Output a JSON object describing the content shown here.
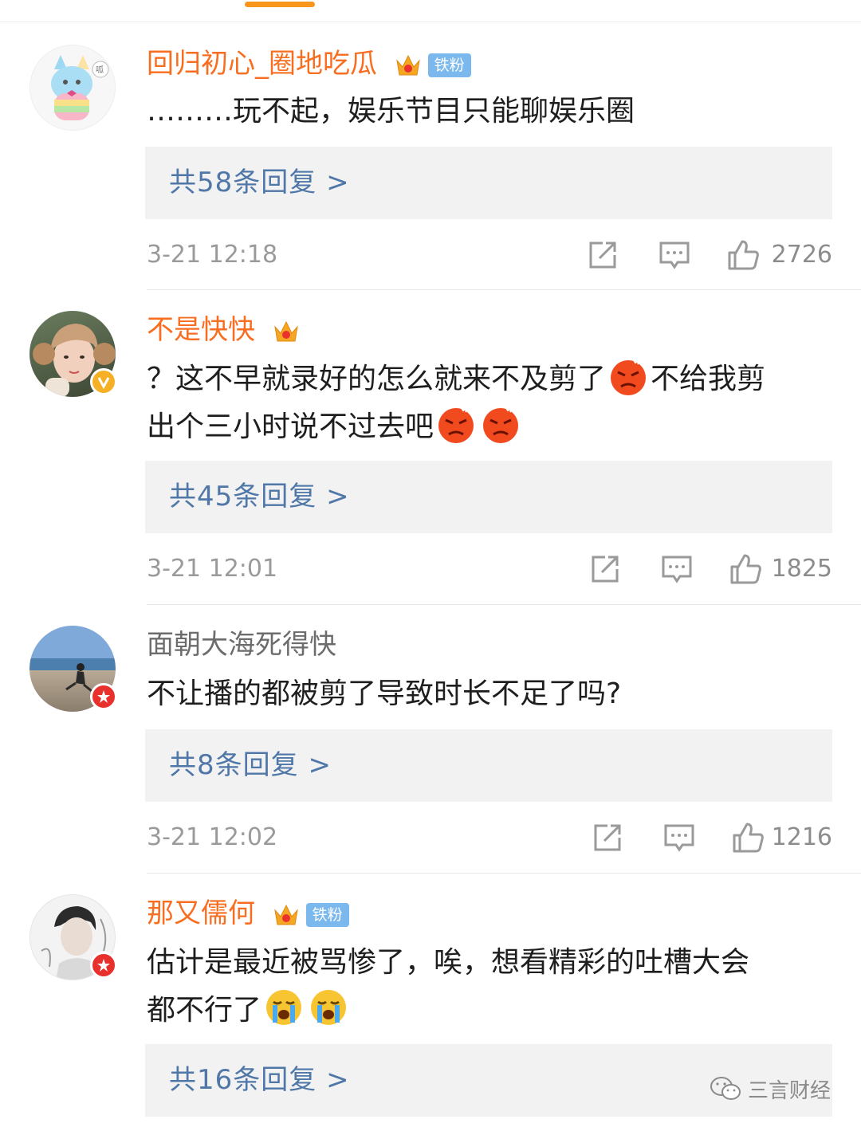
{
  "comments": [
    {
      "username": "回归初心_圈地吃瓜",
      "fan_badge": "铁粉",
      "text": "………玩不起，娱乐节目只能聊娱乐圈",
      "replies": "共58条回复 >",
      "time": "3-21 12:18",
      "likes": "2726"
    },
    {
      "username": "不是快快",
      "text_line1": "？这不早就录好的怎么就来不及剪了",
      "text_line1b": "不给我剪",
      "text_line2": "出个三小时说不过去吧",
      "replies": "共45条回复 >",
      "time": "3-21 12:01",
      "likes": "1825"
    },
    {
      "username": "面朝大海死得快",
      "text": "不让播的都被剪了导致时长不足了吗?",
      "replies": "共8条回复 >",
      "time": "3-21 12:02",
      "likes": "1216"
    },
    {
      "username": "那又儒何",
      "fan_badge": "铁粉",
      "text_line1": "估计是最近被骂惨了，唉，想看精彩的吐槽大会",
      "text_line2": "都不行了",
      "replies": "共16条回复 >",
      "time": "",
      "likes": ""
    }
  ],
  "icons": {
    "share": "share-icon",
    "comment": "comment-icon",
    "like": "thumbs-up-icon",
    "crown": "crown-level-icon",
    "emoji_angry": "angry-emoji-icon",
    "emoji_cry": "crying-emoji-icon"
  },
  "colors": {
    "username_vip": "#f86e21",
    "username_normal": "#6c6c6c",
    "reply_link": "#4f77a8",
    "reply_bg": "#f2f2f2",
    "tab_indicator": "#f7961b"
  },
  "watermark": "三言财经"
}
